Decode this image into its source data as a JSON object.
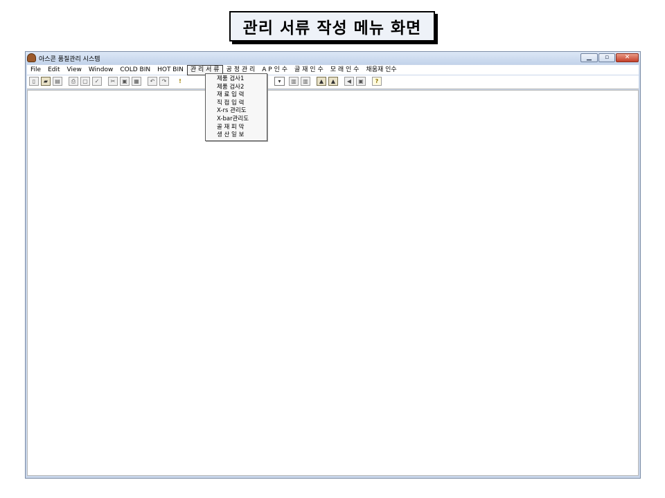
{
  "caption": "관리 서류 작성 메뉴 화면",
  "window": {
    "title": "아스콘 품질관리 시스템",
    "minimize": "▁",
    "maximize": "▫",
    "close": "✕"
  },
  "menu": [
    "File",
    "Edit",
    "View",
    "Window",
    "COLD BIN",
    "HOT BIN",
    "관 리 서 류",
    "공 정 관 리",
    "A P 인 수",
    "골 재 인 수",
    "모 래 인 수",
    "채움재 인수"
  ],
  "dropdown": [
    "제품 검사1",
    "제품 검사2",
    "재 료 입 력",
    "직 접 입 력",
    "X-rs 관리도",
    "X-bar관리도",
    "골 재 피 막",
    "생 산 일 보"
  ],
  "toolbar": {
    "new": "▯",
    "open": "▰",
    "save": "▤",
    "print": "⎙",
    "preview": "▢",
    "spell": "✓",
    "cut": "✂",
    "copy": "▣",
    "paste": "▦",
    "undo": "↶",
    "redo": "↷",
    "exclaim": "!",
    "combo_arrow": "▾",
    "t1": "▥",
    "t2": "▥",
    "t3": "▲",
    "t4": "▲",
    "t5": "◀",
    "t6": "▣",
    "help": "?"
  },
  "icons": [
    "app-icon",
    "new-file-icon",
    "open-folder-icon",
    "save-icon",
    "print-icon",
    "print-preview-icon",
    "spell-check-icon",
    "cut-icon",
    "copy-icon",
    "paste-icon",
    "undo-icon",
    "redo-icon",
    "exclamation-icon",
    "help-icon"
  ]
}
